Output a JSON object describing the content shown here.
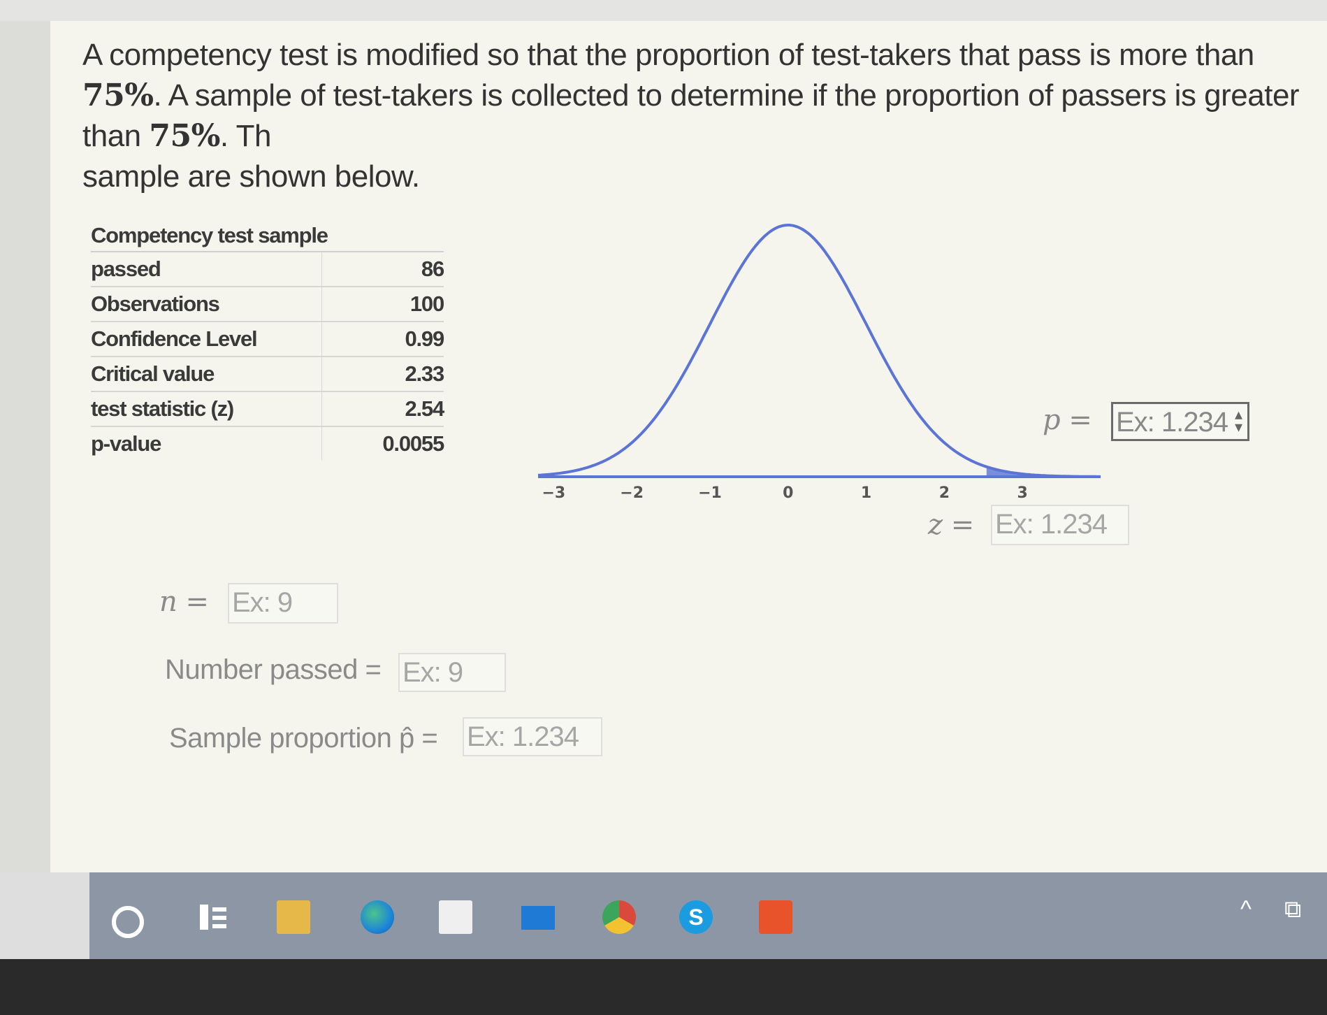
{
  "question": {
    "text_before_1": "A competency test is modified so that the proportion of test-takers that pass is more than ",
    "pct": "75%",
    "text_after_1": ". A sample of test-takers is collected to determine if the proportion of passers is greater than ",
    "text_after_2": ". Th",
    "text_line3": "sample are shown below."
  },
  "table": {
    "title": "Competency test sample",
    "rows": [
      {
        "label": "passed",
        "value": "86"
      },
      {
        "label": "Observations",
        "value": "100"
      },
      {
        "label": "Confidence Level",
        "value": "0.99"
      },
      {
        "label": "Critical value",
        "value": "2.33"
      },
      {
        "label": "test statistic (z)",
        "value": "2.54"
      },
      {
        "label": "p-value",
        "value": "0.0055"
      }
    ]
  },
  "chart_data": {
    "type": "line",
    "x_ticks": [
      "-3",
      "-2",
      "-1",
      "0",
      "1",
      "2",
      "3"
    ],
    "xlim": [
      -3.2,
      4.0
    ],
    "curve": "standard normal density",
    "shaded_from": 2.54,
    "curve_color": "#5b74d6"
  },
  "inputs": {
    "p_label": "p =",
    "p_placeholder": "Ex: 1.234",
    "z_label": "z =",
    "z_placeholder": "Ex: 1.234",
    "n_label": "n =",
    "n_placeholder": "Ex: 9",
    "passed_label": "Number passed =",
    "passed_placeholder": "Ex: 9",
    "prop_label": "Sample proportion p̂ =",
    "prop_placeholder": "Ex: 1.234"
  },
  "taskbar": {
    "icons": [
      "start-icon",
      "task-view-icon",
      "file-explorer-icon",
      "edge-icon",
      "store-icon",
      "mail-icon",
      "chrome-icon",
      "skype-icon",
      "office-icon"
    ],
    "skype_glyph": "S",
    "tray_chevron": "^",
    "tray_glyph": "⧉"
  }
}
